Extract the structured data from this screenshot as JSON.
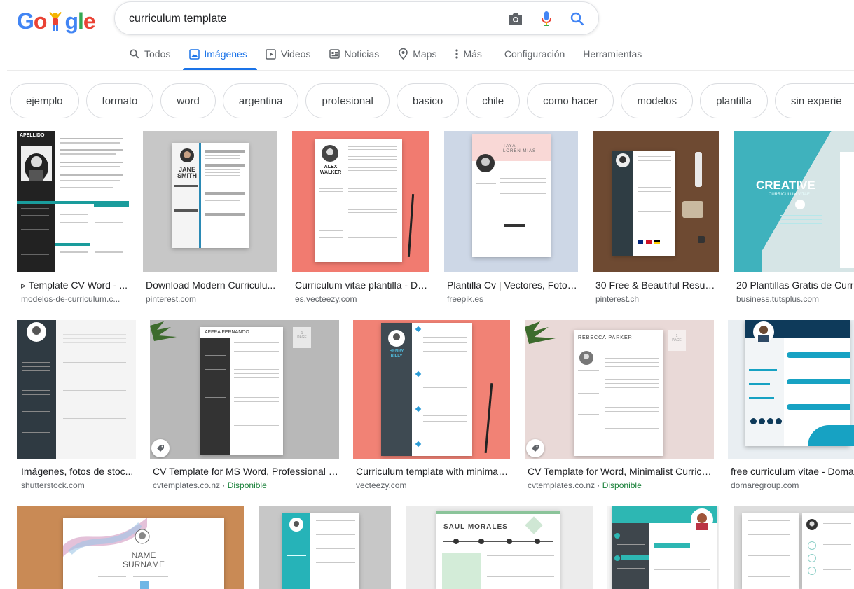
{
  "search": {
    "query": "curriculum template"
  },
  "logo": {
    "letters": [
      "G",
      "o",
      "g",
      "l",
      "e"
    ]
  },
  "tabs": [
    {
      "label": "Todos",
      "icon": "search-icon"
    },
    {
      "label": "Imágenes",
      "icon": "image-icon",
      "active": true
    },
    {
      "label": "Videos",
      "icon": "play-icon"
    },
    {
      "label": "Noticias",
      "icon": "news-icon"
    },
    {
      "label": "Maps",
      "icon": "pin-icon"
    },
    {
      "label": "Más",
      "icon": "more-vert-icon"
    },
    {
      "label": "Configuración"
    },
    {
      "label": "Herramientas"
    }
  ],
  "chips": [
    "ejemplo",
    "formato",
    "word",
    "argentina",
    "profesional",
    "basico",
    "chile",
    "como hacer",
    "modelos",
    "plantilla",
    "sin experie"
  ],
  "results": [
    {
      "title": "▹ Template CV Word - ...",
      "source": "modelos-de-curriculum.c..."
    },
    {
      "title": "Download Modern Curriculu...",
      "source": "pinterest.com"
    },
    {
      "title": "Curriculum vitae plantilla - De...",
      "source": "es.vecteezy.com"
    },
    {
      "title": "Plantilla Cv | Vectores, Fotos...",
      "source": "freepik.es"
    },
    {
      "title": "30 Free & Beautiful Resum...",
      "source": "pinterest.ch"
    },
    {
      "title": "20 Plantillas Gratis de Curri",
      "source": "business.tutsplus.com"
    },
    {
      "title": "Imágenes, fotos de stoc...",
      "source": "shutterstock.com"
    },
    {
      "title": "CV Template for MS Word, Professional C...",
      "source": "cvtemplates.co.nz",
      "available": "Disponible"
    },
    {
      "title": "Curriculum template with minimali...",
      "source": "vecteezy.com"
    },
    {
      "title": "CV Template for Word, Minimalist Curricul...",
      "source": "cvtemplates.co.nz",
      "available": "Disponible"
    },
    {
      "title": "free curriculum vitae - Doma",
      "source": "domaregroup.com"
    }
  ],
  "thumb_text": {
    "t1_name": "APELLIDO",
    "t2_name1": "JANE",
    "t2_name2": "SMITH",
    "t3_name1": "ALEX",
    "t3_name2": "WALKER",
    "t4_name1": "TAYA",
    "t4_name2": "LOREN MIAS",
    "t6_title": "CREATIVE",
    "t6_sub": "CURRICULUM VITAE",
    "t8_name": "AFFRA FERNANDO",
    "t8_page": "1\nPAGE",
    "t9_name": "HENRY\nBILLY",
    "t10_name": "REBECCA PARKER",
    "t12_name1": "NAME",
    "t12_name2": "SURNAME",
    "t14_name": "SAUL MORALES"
  },
  "colors": {
    "google_blue": "#4285f4",
    "google_red": "#ea4335",
    "google_yellow": "#fbbc05",
    "google_green": "#34a853",
    "active_tab": "#1a73e8",
    "available": "#188038"
  }
}
